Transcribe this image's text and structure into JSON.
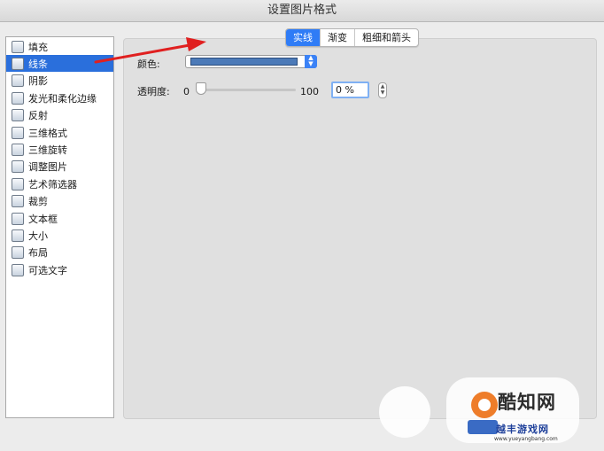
{
  "window": {
    "title": "设置图片格式"
  },
  "sidebar": {
    "items": [
      {
        "label": "填充",
        "icon": "paint-bucket-icon"
      },
      {
        "label": "线条",
        "icon": "line-icon",
        "selected": true
      },
      {
        "label": "阴影",
        "icon": "shadow-icon"
      },
      {
        "label": "发光和柔化边缘",
        "icon": "glow-icon"
      },
      {
        "label": "反射",
        "icon": "reflection-icon"
      },
      {
        "label": "三维格式",
        "icon": "3d-format-icon"
      },
      {
        "label": "三维旋转",
        "icon": "3d-rotation-icon"
      },
      {
        "label": "调整图片",
        "icon": "adjust-picture-icon"
      },
      {
        "label": "艺术筛选器",
        "icon": "artistic-filter-icon"
      },
      {
        "label": "裁剪",
        "icon": "crop-icon"
      },
      {
        "label": "文本框",
        "icon": "text-box-icon"
      },
      {
        "label": "大小",
        "icon": "size-icon"
      },
      {
        "label": "布局",
        "icon": "layout-icon"
      },
      {
        "label": "可选文字",
        "icon": "alt-text-icon"
      }
    ]
  },
  "tabs": [
    {
      "label": "实线",
      "active": true
    },
    {
      "label": "渐变",
      "active": false
    },
    {
      "label": "粗细和箭头",
      "active": false
    }
  ],
  "line": {
    "color_label": "颜色:",
    "color_value": "#4c7ab8",
    "transparency_label": "透明度:",
    "slider_min": "0",
    "slider_max": "100",
    "transparency_percent": 0,
    "transparency_value": "0 %"
  },
  "annotation": {
    "arrow_color": "#e02020"
  },
  "watermark": {
    "name": "酷知网",
    "url_cn": "越丰游戏网",
    "url": "www.yueyangbang.com"
  }
}
